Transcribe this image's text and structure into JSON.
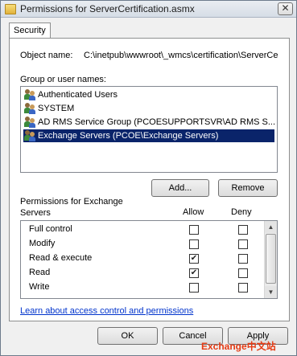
{
  "window": {
    "title": "Permissions for ServerCertification.asmx",
    "close_glyph": "✕"
  },
  "tabs": [
    {
      "label": "Security"
    }
  ],
  "object": {
    "label": "Object name:",
    "value": "C:\\inetpub\\wwwroot\\_wmcs\\certification\\ServerCe"
  },
  "groups": {
    "label": "Group or user names:",
    "items": [
      {
        "name": "Authenticated Users",
        "icon": "users-group-icon",
        "selected": false
      },
      {
        "name": "SYSTEM",
        "icon": "users-group-icon",
        "selected": false
      },
      {
        "name": "AD RMS Service Group (PCOESUPPORTSVR\\AD RMS S...",
        "icon": "users-group-icon",
        "selected": false
      },
      {
        "name": "Exchange Servers (PCOE\\Exchange Servers)",
        "icon": "users-group-icon",
        "selected": true
      }
    ],
    "add_label": "Add...",
    "remove_label": "Remove"
  },
  "permissions": {
    "label_line1": "Permissions for Exchange",
    "label_line2": "Servers",
    "allow_header": "Allow",
    "deny_header": "Deny",
    "rows": [
      {
        "name": "Full control",
        "allow": false,
        "deny": false
      },
      {
        "name": "Modify",
        "allow": false,
        "deny": false
      },
      {
        "name": "Read & execute",
        "allow": true,
        "deny": false
      },
      {
        "name": "Read",
        "allow": true,
        "deny": false
      },
      {
        "name": "Write",
        "allow": false,
        "deny": false
      }
    ]
  },
  "help_link": "Learn about access control and permissions",
  "buttons": {
    "ok": "OK",
    "cancel": "Cancel",
    "apply": "Apply"
  },
  "watermark": "Exchange中文站",
  "colors": {
    "selection": "#0a246a",
    "link": "#0033cc",
    "watermark": "#e63b14"
  }
}
